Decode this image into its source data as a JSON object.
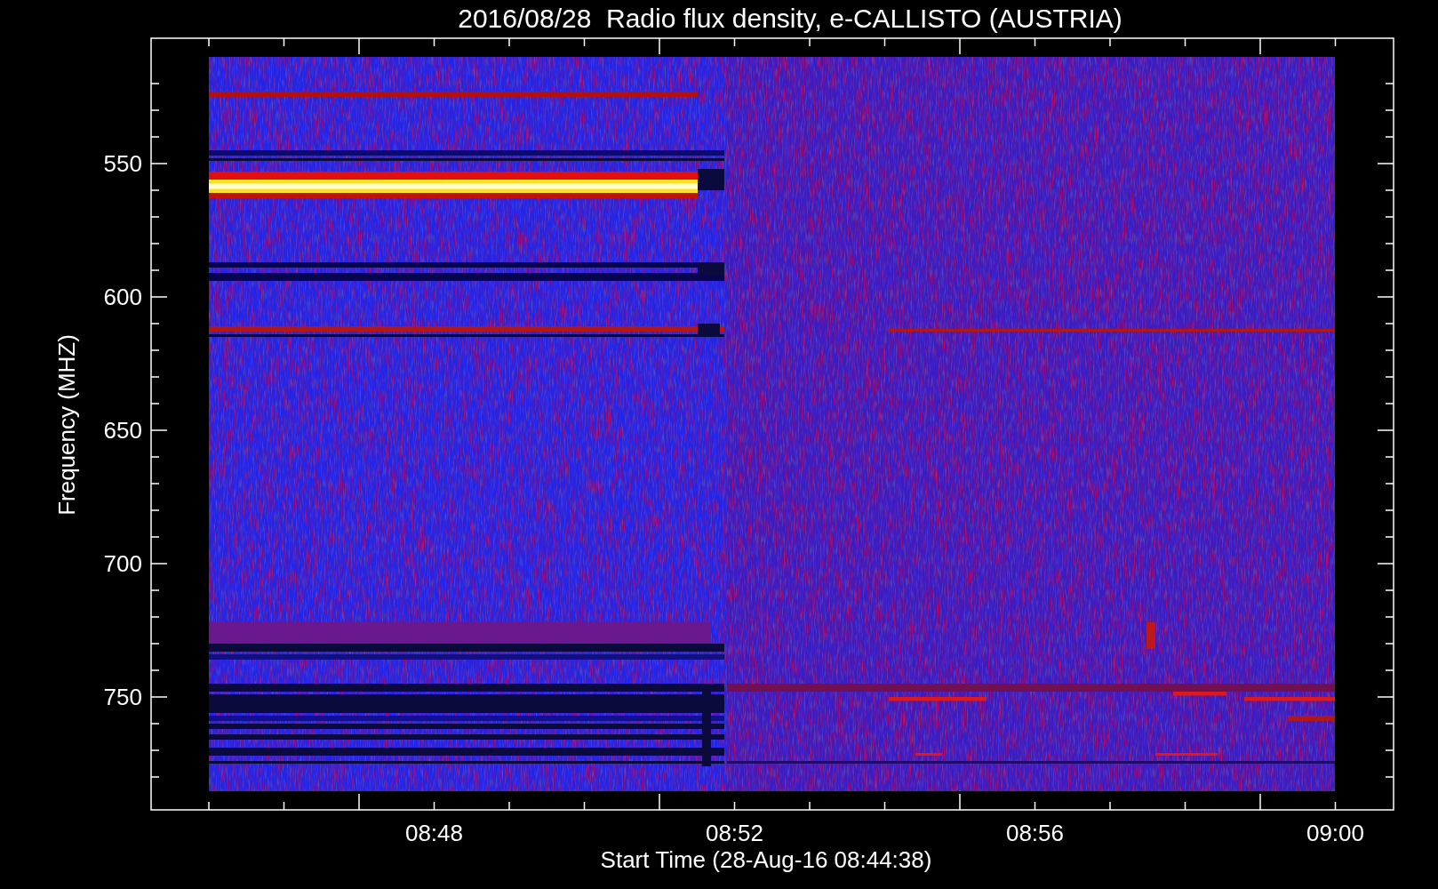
{
  "title": "2016/08/28  Radio flux density, e-CALLISTO (AUSTRIA)",
  "y_axis": {
    "label": "Frequency (MHZ)",
    "tick_labels": [
      "550",
      "600",
      "650",
      "700",
      "750"
    ]
  },
  "x_axis": {
    "label": "Start Time (28-Aug-16 08:44:38)",
    "tick_labels": [
      "08:48",
      "08:52",
      "08:56",
      "09:00"
    ]
  }
}
